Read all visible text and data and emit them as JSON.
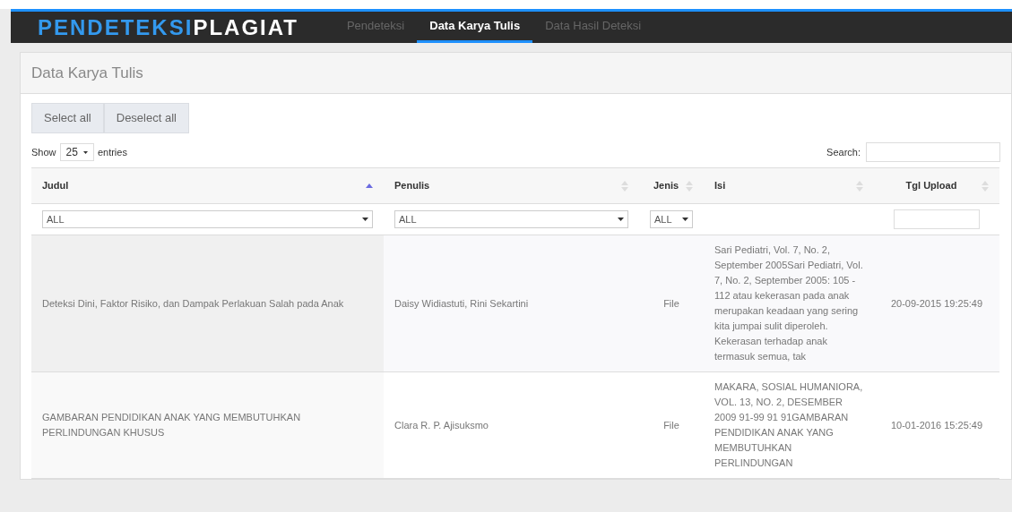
{
  "navbar": {
    "brand": {
      "primary": "PENDETEKSI",
      "secondary": "PLAGIAT"
    },
    "items": [
      {
        "label": "Pendeteksi",
        "selected": false
      },
      {
        "label": "Data Karya Tulis",
        "selected": true
      },
      {
        "label": "Data Hasil Deteksi",
        "selected": false
      }
    ]
  },
  "panel": {
    "title": "Data Karya Tulis"
  },
  "buttons": [
    "Select all",
    "Deselect all"
  ],
  "length": {
    "prefix": "Show",
    "value": "25",
    "suffix": "entries"
  },
  "search": {
    "label": "Search:"
  },
  "table": {
    "columns": [
      {
        "label": "Judul",
        "sorted": true,
        "filter": {
          "kind": "select",
          "value": "ALL"
        }
      },
      {
        "label": "Penulis",
        "sorted": false,
        "filter": {
          "kind": "select",
          "value": "ALL"
        }
      },
      {
        "label": "Jenis",
        "sorted": false,
        "filter": {
          "kind": "select",
          "value": "ALL"
        }
      },
      {
        "label": "Isi",
        "sorted": false,
        "filter": {
          "kind": "empty"
        }
      },
      {
        "label": "Tgl Upload",
        "sorted": false,
        "filter": {
          "kind": "text"
        }
      }
    ],
    "rows": [
      {
        "cells": [
          "Deteksi Dini, Faktor Risiko, dan Dampak Perlakuan Salah pada Anak",
          "Daisy Widiastuti, Rini Sekartini",
          "File",
          "Sari Pediatri, Vol. 7, No. 2, September 2005Sari Pediatri, Vol. 7, No. 2, September 2005: 105 - 112 atau kekerasan pada anak merupakan keadaan yang sering kita jumpai sulit diperoleh. Kekerasan terhadap anak termasuk semua, tak",
          "20-09-2015 19:25:49"
        ]
      },
      {
        "cells": [
          "GAMBARAN PENDIDIKAN ANAK YANG MEMBUTUHKAN PERLINDUNGAN KHUSUS",
          "Clara R. P. Ajisuksmo",
          "File",
          "MAKARA, SOSIAL HUMANIORA, VOL. 13, NO. 2, DESEMBER 2009 91-99 91 91GAMBARAN PENDIDIKAN ANAK YANG MEMBUTUHKAN PERLINDUNGAN",
          "10-01-2016 15:25:49"
        ]
      }
    ]
  }
}
